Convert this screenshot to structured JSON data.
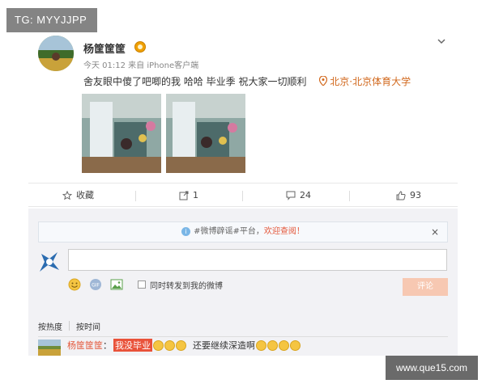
{
  "watermark_top": "TG: MYYJJPP",
  "watermark_bottom": "www.que15.com",
  "post": {
    "username": "杨筐筐筐",
    "meta": "今天 01:12 来自 iPhone客户端",
    "text": "舍友眼中傻了吧唧的我 哈哈 毕业季 祝大家一切顺利",
    "location": "北京·北京体育大学"
  },
  "actions": {
    "favorite_label": "收藏",
    "repost_count": "1",
    "comment_count": "24",
    "like_count": "93"
  },
  "comment_box": {
    "notice_text": "#微博辟谣#平台，",
    "notice_link": "欢迎查阅！",
    "notice_close": "×",
    "repost_label": "同时转发到我的微博",
    "submit_label": "评论"
  },
  "sort": {
    "hot_label": "按热度",
    "time_label": "按时间"
  },
  "reply": {
    "user": "杨筐筐筐",
    "colon": "：",
    "tag": "我没毕业",
    "text": "还要继续深造啊"
  },
  "colors": {
    "accent": "#e4573a",
    "location": "#d2691e",
    "submit": "#f7c8b2"
  }
}
